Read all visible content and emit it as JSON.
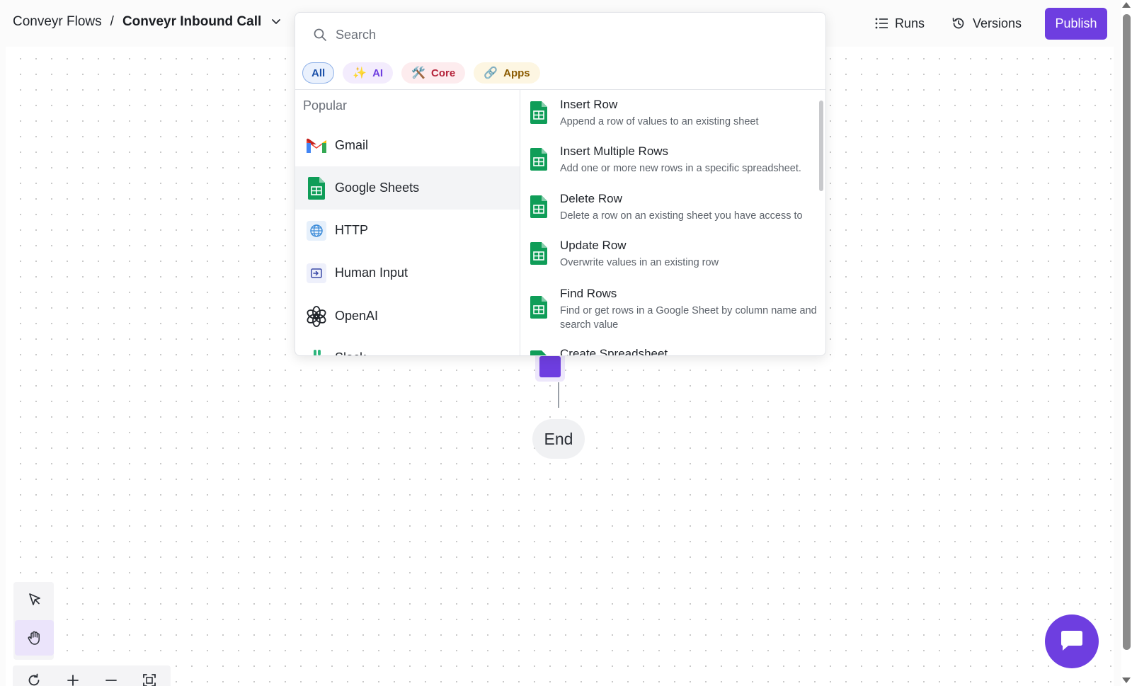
{
  "header": {
    "breadcrumb_parent": "Conveyr Flows",
    "breadcrumb_sep": "/",
    "breadcrumb_current": "Conveyr Inbound Call",
    "runs_label": "Runs",
    "versions_label": "Versions",
    "publish_label": "Publish"
  },
  "picker": {
    "search_placeholder": "Search",
    "chips": [
      {
        "label": "All",
        "icon": ""
      },
      {
        "label": "AI",
        "icon": "✨"
      },
      {
        "label": "Core",
        "icon": "🛠️"
      },
      {
        "label": "Apps",
        "icon": "🔗"
      }
    ],
    "section_label": "Popular",
    "apps": [
      {
        "label": "Gmail",
        "icon": "gmail-icon"
      },
      {
        "label": "Google Sheets",
        "icon": "google-sheets-icon",
        "selected": true
      },
      {
        "label": "HTTP",
        "icon": "globe-icon"
      },
      {
        "label": "Human Input",
        "icon": "input-icon"
      },
      {
        "label": "OpenAI",
        "icon": "openai-icon"
      },
      {
        "label": "Slack",
        "icon": "slack-icon"
      }
    ],
    "actions": [
      {
        "title": "Insert Row",
        "desc": "Append a row of values to an existing sheet"
      },
      {
        "title": "Insert Multiple Rows",
        "desc": "Add one or more new rows in a specific spreadsheet."
      },
      {
        "title": "Delete Row",
        "desc": "Delete a row on an existing sheet you have access to"
      },
      {
        "title": "Update Row",
        "desc": "Overwrite values in an existing row"
      },
      {
        "title": "Find Rows",
        "desc": "Find or get rows in a Google Sheet by column name and search value"
      },
      {
        "title": "Create Spreadsheet",
        "desc": ""
      }
    ]
  },
  "canvas": {
    "end_label": "End"
  },
  "colors": {
    "accent": "#6e3ee0",
    "sheets_green": "#0f9d58"
  }
}
